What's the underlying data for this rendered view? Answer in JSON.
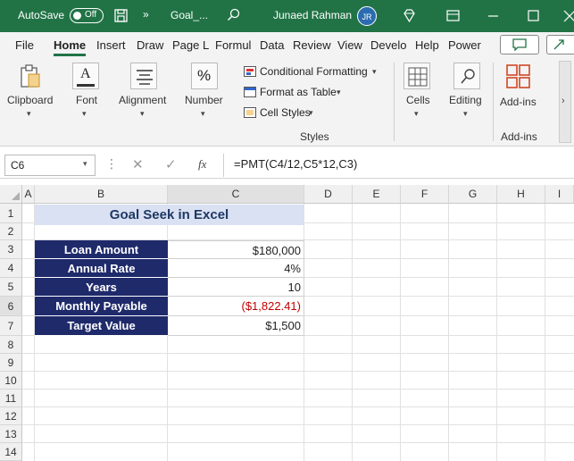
{
  "titlebar": {
    "autosave_label": "AutoSave",
    "autosave_state": "Off",
    "filename": "Goal_...",
    "user_name": "Junaed Rahman",
    "user_initials": "JR"
  },
  "menu": {
    "tabs": [
      "File",
      "Home",
      "Insert",
      "Draw",
      "Page L",
      "Formul",
      "Data",
      "Review",
      "View",
      "Develo",
      "Help",
      "Power"
    ],
    "active": "Home"
  },
  "ribbon": {
    "clipboard": "Clipboard",
    "font": "Font",
    "alignment": "Alignment",
    "number": "Number",
    "number_glyph": "%",
    "conditional_formatting": "Conditional Formatting",
    "format_as_table": "Format as Table",
    "cell_styles": "Cell Styles",
    "styles_group": "Styles",
    "cells": "Cells",
    "editing": "Editing",
    "addins": "Add-ins",
    "addins_group": "Add-ins"
  },
  "formula_bar": {
    "name_box": "C6",
    "fx": "fx",
    "formula": "=PMT(C4/12,C5*12,C3)"
  },
  "sheet": {
    "columns": [
      "A",
      "B",
      "C",
      "D",
      "E",
      "F",
      "G",
      "H",
      "I"
    ],
    "rows": [
      "1",
      "2",
      "3",
      "4",
      "5",
      "6",
      "7",
      "8",
      "9",
      "10",
      "11",
      "12",
      "13",
      "14"
    ],
    "title": "Goal Seek in Excel",
    "table": [
      {
        "label": "Loan Amount",
        "value": "$180,000"
      },
      {
        "label": "Annual Rate",
        "value": "4%"
      },
      {
        "label": "Years",
        "value": "10"
      },
      {
        "label": "Monthly Payable",
        "value": "($1,822.41)"
      },
      {
        "label": "Target Value",
        "value": "$1,500"
      }
    ]
  },
  "colors": {
    "excel_green": "#217346",
    "label_fill": "#1f2a6b",
    "title_fill": "#d9e1f2",
    "negative_red": "#c00000"
  }
}
